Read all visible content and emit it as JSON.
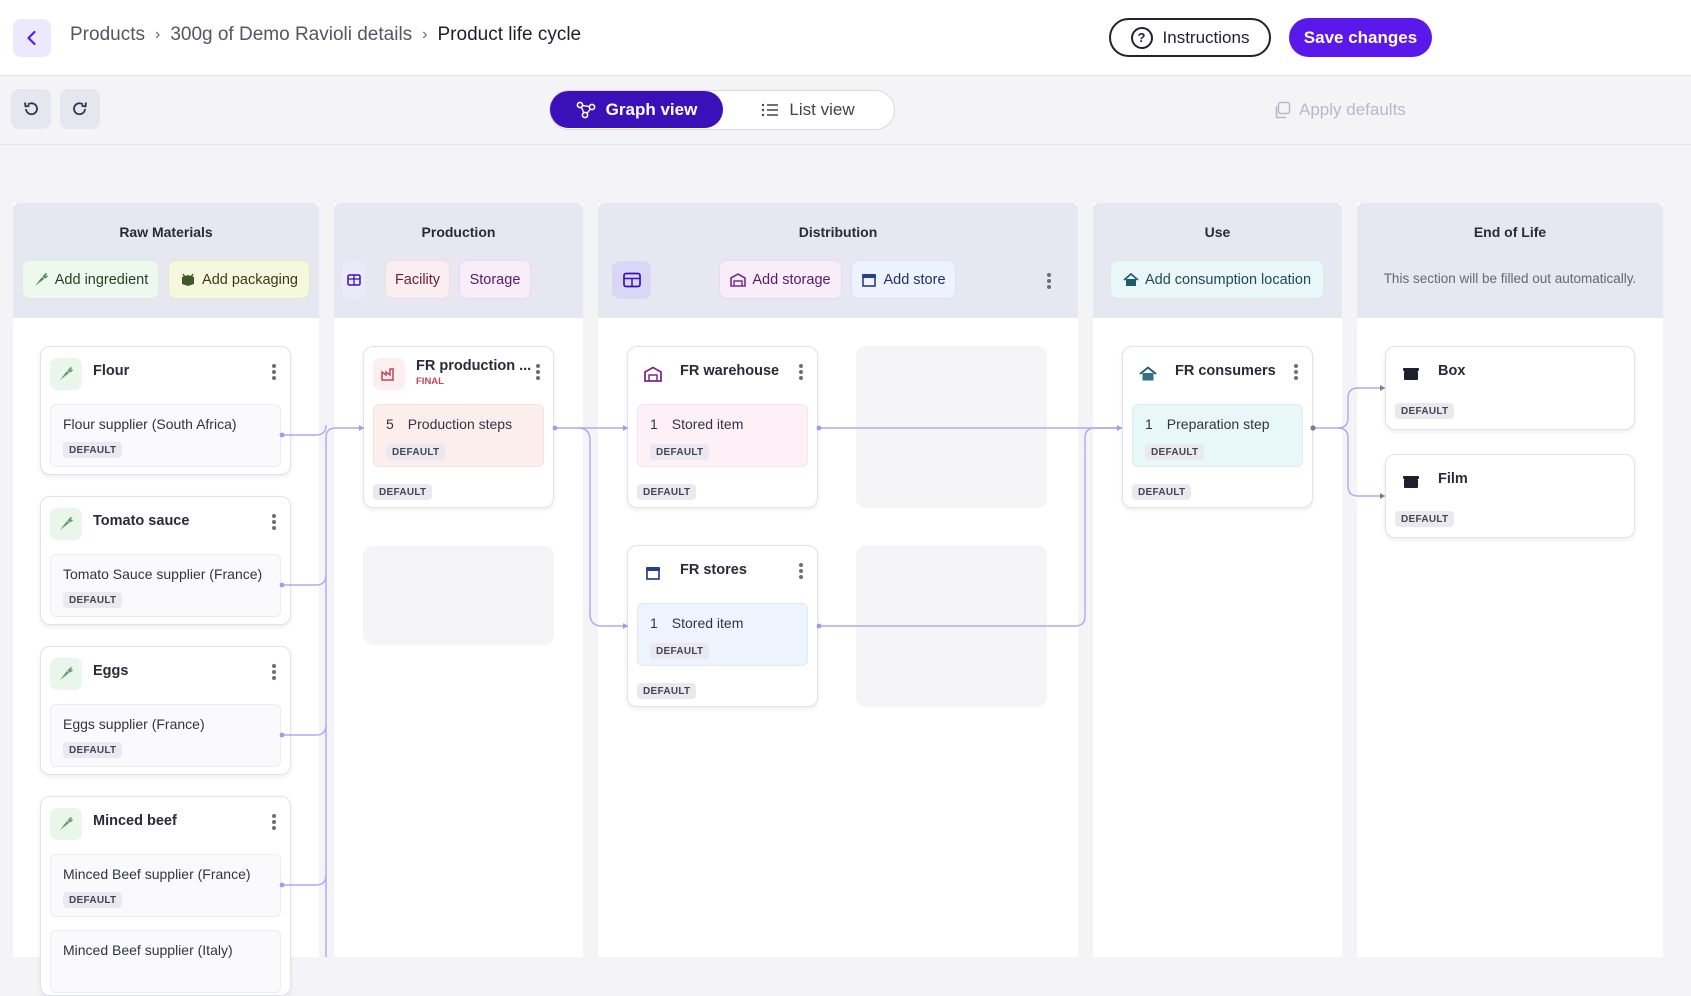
{
  "header": {
    "breadcrumb": [
      {
        "label": "Products"
      },
      {
        "label": "300g of Demo Ravioli details"
      },
      {
        "label": "Product life cycle"
      }
    ],
    "instructions_label": "Instructions",
    "save_label": "Save changes"
  },
  "toolbar": {
    "graph_view_label": "Graph view",
    "list_view_label": "List view",
    "apply_defaults_label": "Apply defaults",
    "active_view": "graph"
  },
  "columns": {
    "raw_materials": {
      "title": "Raw Materials",
      "add_ingredient_label": "Add ingredient",
      "add_packaging_label": "Add packaging",
      "cards": [
        {
          "name": "Flour",
          "supplier": "Flour supplier (South Africa)",
          "badge": "DEFAULT"
        },
        {
          "name": "Tomato sauce",
          "supplier": "Tomato Sauce supplier (France)",
          "badge": "DEFAULT"
        },
        {
          "name": "Eggs",
          "supplier": "Eggs supplier (France)",
          "badge": "DEFAULT"
        },
        {
          "name": "Minced beef",
          "supplier": "Minced Beef supplier (France)",
          "badge": "DEFAULT",
          "supplier2": "Minced Beef supplier (Italy)"
        }
      ]
    },
    "production": {
      "title": "Production",
      "facility_label": "Facility",
      "storage_label": "Storage",
      "card": {
        "name": "FR production ...",
        "tag": "FINAL",
        "steps_count": "5",
        "steps_label": "Production steps",
        "inner_badge": "DEFAULT",
        "badge": "DEFAULT"
      }
    },
    "distribution": {
      "title": "Distribution",
      "add_storage_label": "Add storage",
      "add_store_label": "Add store",
      "warehouse": {
        "name": "FR warehouse",
        "count": "1",
        "item_label": "Stored item",
        "inner_badge": "DEFAULT",
        "badge": "DEFAULT"
      },
      "stores": {
        "name": "FR stores",
        "count": "1",
        "item_label": "Stored item",
        "inner_badge": "DEFAULT",
        "badge": "DEFAULT"
      }
    },
    "use": {
      "title": "Use",
      "add_location_label": "Add consumption location",
      "card": {
        "name": "FR consumers",
        "count": "1",
        "item_label": "Preparation step",
        "inner_badge": "DEFAULT",
        "badge": "DEFAULT"
      }
    },
    "end_of_life": {
      "title": "End of Life",
      "note": "This section will be filled out automatically.",
      "cards": [
        {
          "name": "Box",
          "badge": "DEFAULT"
        },
        {
          "name": "Film",
          "badge": "DEFAULT"
        }
      ]
    }
  },
  "colors": {
    "accent": "#5a18ea",
    "toggle_active": "#3a11b8",
    "link_line": "#b3a6f3"
  },
  "icons": {
    "back": "chevron-left-icon",
    "undo": "undo-icon",
    "redo": "redo-icon",
    "graph": "graph-icon",
    "list": "list-icon",
    "apply": "copy-icon",
    "ingredient": "carrot-icon",
    "packaging": "package-icon",
    "factory": "factory-icon",
    "warehouse": "warehouse-icon",
    "store": "store-icon",
    "home": "home-icon",
    "bin": "bin-icon"
  }
}
